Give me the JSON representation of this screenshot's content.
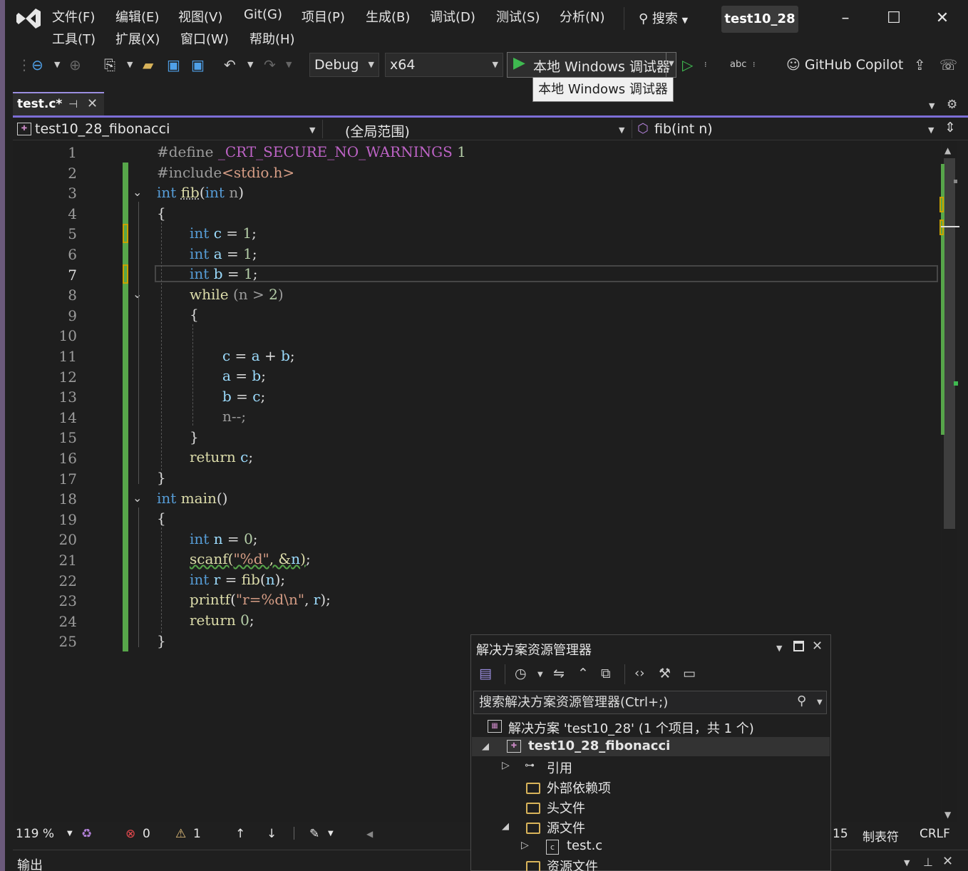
{
  "menu": {
    "row1": [
      "文件(F)",
      "编辑(E)",
      "视图(V)",
      "Git(G)",
      "项目(P)",
      "生成(B)",
      "调试(D)",
      "测试(S)",
      "分析(N)"
    ],
    "row2": [
      "工具(T)",
      "扩展(X)",
      "窗口(W)",
      "帮助(H)"
    ],
    "search": "搜索",
    "solution_name": "test10_28"
  },
  "toolbar": {
    "config": "Debug",
    "platform": "x64",
    "run_label": "本地 Windows 调试器",
    "tooltip": "本地 Windows 调试器",
    "copilot": "GitHub Copilot"
  },
  "tab": {
    "label": "test.c*"
  },
  "navbar": {
    "project": "test10_28_fibonacci",
    "scope": "(全局范围)",
    "member": "fib(int n)"
  },
  "editor": {
    "current_line": 7,
    "lines": [
      "1",
      "2",
      "3",
      "4",
      "5",
      "6",
      "7",
      "8",
      "9",
      "10",
      "11",
      "12",
      "13",
      "14",
      "15",
      "16",
      "17",
      "18",
      "19",
      "20",
      "21",
      "22",
      "23",
      "24",
      "25"
    ]
  },
  "status": {
    "zoom": "119 %",
    "errors": "0",
    "warnings": "1",
    "col_fragment": "15",
    "indent": "制表符",
    "eol": "CRLF"
  },
  "output": {
    "title": "输出"
  },
  "solution_explorer": {
    "title": "解决方案资源管理器",
    "search_placeholder": "搜索解决方案资源管理器(Ctrl+;)",
    "solution": "解决方案 'test10_28' (1 个项目，共 1 个)",
    "project": "test10_28_fibonacci",
    "references": "引用",
    "external": "外部依赖项",
    "headers": "头文件",
    "sources": "源文件",
    "file": "test.c",
    "resources": "资源文件"
  },
  "colors": {
    "accent": "#7c6ed6",
    "keyword": "#569cd6",
    "function": "#dcdcaa",
    "variable": "#9cdcfe",
    "number": "#b5cea8",
    "string": "#d69d85",
    "changed_bar": "#57a64a"
  }
}
